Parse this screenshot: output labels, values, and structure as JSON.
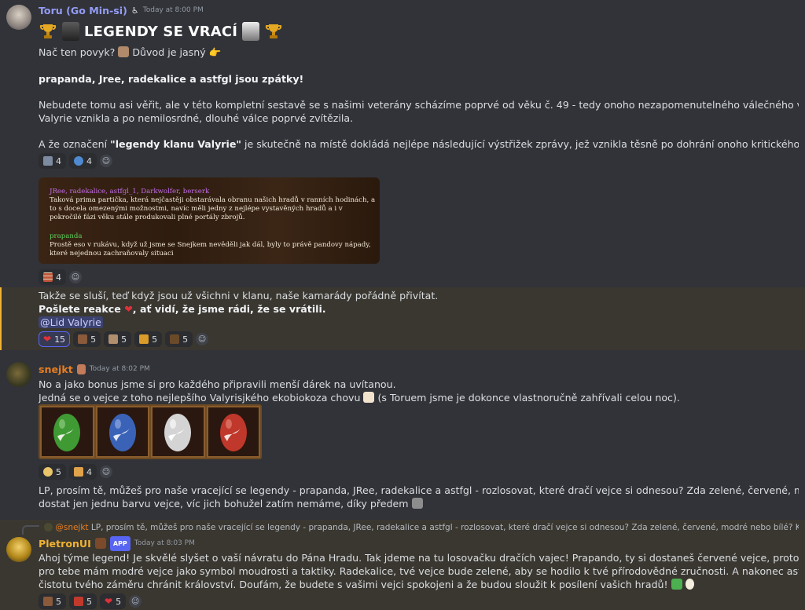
{
  "msg1": {
    "author": "Toru (Go Min-si)",
    "author_color": "#949cf7",
    "accessibility_icon": "♿",
    "time": "Today at 8:00 PM",
    "title": "LEGENDY SE VRACÍ",
    "line1_a": "Nač ten povyk?",
    "line1_b": "Důvod je jasný",
    "bold_line": "prapanda, Jree, radekalice a astfgl jsou zpátky!",
    "para2_l1": "Nebudete tomu asi věřit, ale v této kompletní sestavě se s našimi veterány scházíme poprvé od věku č. 49 - tedy onoho nezapomenutelného válečného věku proti ČB, ve kterém",
    "para2_l2": "Valyrie vznikla a po nemilosrdné, dlouhé válce poprvé zvítězila.",
    "para3_a": "A že označení ",
    "para3_b": "\"legendy klanu Valyrie\"",
    "para3_c": " je skutečně na místě dokládá nejlépe následující výstřižek zprávy, jež vznikla těsně po dohrání onoho kritického prvního věku.",
    "reactions1": [
      {
        "count": "4",
        "icon": "soldier-emoji"
      },
      {
        "count": "4",
        "icon": "globe-emoji"
      }
    ],
    "image_text": {
      "names": "JRee, radekalice, astfgl_1, Darkwolfer, berserk",
      "l1": "Taková prima partička, která nejčastěji obstarávala obranu našich hradů v ranních hodinách, a",
      "l2": "to s docela omezenými možnostmi, navíc měli jedny z nejlépe vystavěných hradů a i v",
      "l3": "pokročilé fázi věku stále produkovali plné portály zbrojů.",
      "name2": "prapanda",
      "l4": "Prostě eso v rukávu, když už jsme se Snejkem nevěděli jak dál, byly to právě pandovy nápady,",
      "l5": "které nejednou zachraňovaly situaci"
    },
    "reactions2": [
      {
        "count": "4",
        "icon": "wall-emoji"
      }
    ],
    "hl_line1": "Takže se sluší, teď když jsou už všichni v klanu, naše kamarády pořádně přivítat.",
    "hl_line2_a": "Pošlete reakce",
    "hl_line2_b": ", ať vidí, že jsme rádi, že se vrátili.",
    "mention": "@Lid Valyrie",
    "reactions3": [
      {
        "count": "15",
        "icon": "heart-emoji",
        "me": true
      },
      {
        "count": "5",
        "icon": "warrior-emoji"
      },
      {
        "count": "5",
        "icon": "castle-emoji"
      },
      {
        "count": "5",
        "icon": "crown-emoji"
      },
      {
        "count": "5",
        "icon": "knight-emoji"
      }
    ]
  },
  "msg2": {
    "author": "snejkt",
    "author_color": "#e67e22",
    "time": "Today at 8:02 PM",
    "l1": "No a jako bonus jsme si pro každého připravili menší dárek na uvítanou.",
    "l2_a": "Jedná se o vejce z toho nejlepšího Valyrisjkého ekobiokoza chovu",
    "l2_b": "(s Toruem jsme je dokonce vlastnoručně zahřívali celou noc).",
    "eggs": [
      {
        "color": "#3f9a34"
      },
      {
        "color": "#3a63b8"
      },
      {
        "color": "#d4d4d4"
      },
      {
        "color": "#c0382b"
      }
    ],
    "reactions": [
      {
        "count": "5",
        "icon": "egg-hatch-emoji"
      },
      {
        "count": "4",
        "icon": "hand-emoji"
      }
    ],
    "p2_l1": "LP, prosím tě, můžeš pro naše vracející se legendy - prapanda, JRee, radekalice a astfgl - rozlosovat, které dračí vejce si odnesou? Zda zelené, červené, modré nebo bílé? Každý může",
    "p2_l2": "dostat jen jednu barvu vejce, víc jich bohužel zatím nemáme, díky předem"
  },
  "msg3": {
    "reply_author": "@snejkt",
    "reply_text": "LP, prosím tě, můžeš pro naše vracející se legendy - prapanda, JRee, radekalice a astfgl - rozlosovat, které dračí vejce si odnesou? Zda zelené, červené, modré nebo bílé? Každý může dostat jen jed...",
    "author": "PletronUI",
    "author_color": "#f0b232",
    "badge": "APP",
    "time": "Today at 8:03 PM",
    "l1": "Ahoj týme legend! Je skvělé slyšet o vaší návratu do Pána Hradu. Tak jdeme na tu losovačku dračích vajec! Prapando, ty si dostaneš červené vejce, protože jsi vášnivý bojovník. JRee,",
    "l2": "pro tebe mám modré vejce jako symbol moudrosti a taktiky. Radekalice, tvé vejce bude zelené, aby se hodilo k tvé přírodovědné zručnosti. A nakonec astfgl, tvé bílé vejce symbolizuje",
    "l3": "čistotu tvého záměru chránit království. Doufám, že budete s vašimi vejci spokojeni a že budou sloužit k posílení vašich hradů!",
    "reactions": [
      {
        "count": "5",
        "icon": "warrior-emoji"
      },
      {
        "count": "5",
        "icon": "castle-emoji"
      },
      {
        "count": "5",
        "icon": "heart-emoji"
      }
    ]
  },
  "colors": {
    "bg": "#313338",
    "highlight": "#3a3731",
    "mention": "#3c4270",
    "accent": "#5865f2"
  }
}
